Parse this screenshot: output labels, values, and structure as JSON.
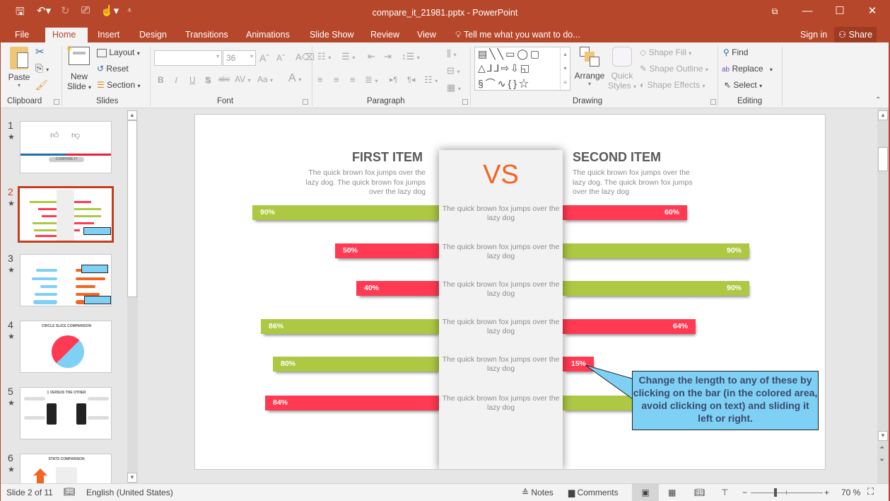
{
  "window": {
    "title": "compare_it_21981.pptx - PowerPoint",
    "quick_access": [
      "save-icon",
      "undo-icon",
      "redo-icon",
      "present-from-start-icon",
      "touch-mode-icon",
      "customize-qat-icon"
    ]
  },
  "tabs": [
    {
      "label": "File"
    },
    {
      "label": "Home",
      "active": true
    },
    {
      "label": "Insert"
    },
    {
      "label": "Design"
    },
    {
      "label": "Transitions"
    },
    {
      "label": "Animations"
    },
    {
      "label": "Slide Show"
    },
    {
      "label": "Review"
    },
    {
      "label": "View"
    }
  ],
  "tell_me": "Tell me what you want to do...",
  "sign_in": "Sign in",
  "share": "Share",
  "ribbon": {
    "clipboard": {
      "label": "Clipboard",
      "paste": "Paste"
    },
    "slides": {
      "label": "Slides",
      "new_slide_1": "New",
      "new_slide_2": "Slide",
      "layout": "Layout",
      "reset": "Reset",
      "section": "Section"
    },
    "font": {
      "label": "Font",
      "font_name": "",
      "font_size": "36",
      "bold": "B",
      "italic": "I",
      "underline": "U",
      "shadow": "S",
      "strike": "abc",
      "spacing": "AV",
      "case": "Aa",
      "color": "A"
    },
    "paragraph": {
      "label": "Paragraph"
    },
    "drawing": {
      "label": "Drawing",
      "arrange": "Arrange",
      "quick_styles_1": "Quick",
      "quick_styles_2": "Styles",
      "shape_fill": "Shape Fill",
      "shape_outline": "Shape Outline",
      "shape_effects": "Shape Effects"
    },
    "editing": {
      "label": "Editing",
      "find": "Find",
      "replace": "Replace",
      "select": "Select"
    }
  },
  "thumbnails": [
    {
      "num": "1",
      "title": "COMPARE IT"
    },
    {
      "num": "2",
      "active": true
    },
    {
      "num": "3"
    },
    {
      "num": "4",
      "title": "CIRCLE SLICE COMPARISON"
    },
    {
      "num": "5",
      "title": "1 VERSUS THE OTHER"
    },
    {
      "num": "6",
      "title": "STATS COMPARISON"
    }
  ],
  "slide": {
    "first_item": {
      "title": "FIRST ITEM",
      "desc": "The quick brown fox jumps over the lazy dog. The quick brown fox jumps over the lazy dog"
    },
    "second_item": {
      "title": "SECOND ITEM",
      "desc": "The quick brown fox jumps over the lazy dog. The quick brown fox jumps over the lazy dog"
    },
    "vs": "VS",
    "rows": [
      {
        "center": "The quick brown fox jumps over the lazy dog",
        "left": {
          "value": 90,
          "label": "90%",
          "color": "#adc843"
        },
        "right": {
          "value": 60,
          "label": "60%",
          "color": "#ff3a52"
        }
      },
      {
        "center": "The quick brown fox jumps over the lazy dog",
        "left": {
          "value": 50,
          "label": "50%",
          "color": "#ff3a52"
        },
        "right": {
          "value": 90,
          "label": "90%",
          "color": "#adc843"
        }
      },
      {
        "center": "The quick brown fox jumps over the lazy dog",
        "left": {
          "value": 40,
          "label": "40%",
          "color": "#ff3a52"
        },
        "right": {
          "value": 90,
          "label": "90%",
          "color": "#adc843"
        }
      },
      {
        "center": "The quick brown fox jumps over the lazy dog",
        "left": {
          "value": 86,
          "label": "86%",
          "color": "#adc843"
        },
        "right": {
          "value": 64,
          "label": "64%",
          "color": "#ff3a52"
        }
      },
      {
        "center": "The quick brown fox jumps over the lazy dog",
        "left": {
          "value": 80,
          "label": "80%",
          "color": "#adc843"
        },
        "right": {
          "value": 15,
          "label": "15%",
          "color": "#ff3a52"
        }
      },
      {
        "center": "The quick brown fox jumps over the lazy dog",
        "left": {
          "value": 84,
          "label": "84%",
          "color": "#ff3a52"
        },
        "right": {
          "value": 90,
          "label": "",
          "color": "#adc843"
        }
      }
    ],
    "callout": "Change the length to any of these by clicking on the bar (in the colored area, avoid clicking on text) and sliding it left or right."
  },
  "status": {
    "slide_info": "Slide 2 of 11",
    "language": "English (United States)",
    "notes": "Notes",
    "comments": "Comments",
    "zoom": "70 %",
    "zoom_level_percent": 70
  },
  "colors": {
    "accent": "#b7472a",
    "green": "#adc843",
    "red": "#ff3a52",
    "vs": "#f26522",
    "callout": "#7fd0f5"
  }
}
